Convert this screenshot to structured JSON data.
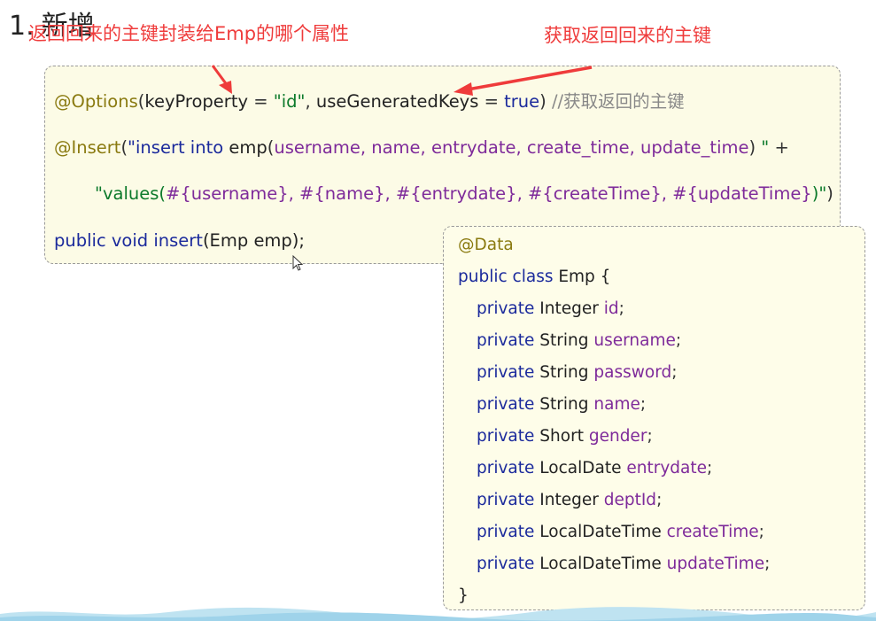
{
  "heading": {
    "number": "1.",
    "title": "新增"
  },
  "annotations": {
    "left": "返回回来的主键封装给Emp的哪个属性",
    "right": "获取返回回来的主键"
  },
  "mapper_code": {
    "l1_annotation": "@Options",
    "l1_paren_open": "(",
    "l1_key": "keyProperty",
    "l1_eq1": " = ",
    "l1_value1": "\"id\"",
    "l1_comma": ", ",
    "l1_key2": "useGeneratedKeys",
    "l1_eq2": " = ",
    "l1_value2": "true",
    "l1_paren_close": ")",
    "l1_comment": " //获取返回的主键",
    "l2_annotation": "@Insert",
    "l2_paren_open": "(",
    "l2_str_start": "\"insert into ",
    "l2_table": "emp",
    "l2_p_open": "(",
    "l2_columns": "username, name, entrydate, create_time, update_time",
    "l2_p_close": ")",
    "l2_str_end": " \"",
    "l2_plus": " +",
    "l3_str_start": "\"values(",
    "l3_params": "#{username}, #{name}, #{entrydate}, #{createTime}, #{updateTime}",
    "l3_str_end": ")\"",
    "l3_paren_close": ")",
    "l4_keywords": "public void insert",
    "l4_args": "(Emp emp);"
  },
  "class_code": {
    "annotation": "@Data",
    "decl_keywords": "public class",
    "decl_name": " Emp {",
    "fields": [
      {
        "mod": "private",
        "type": " Integer ",
        "name": "id",
        "end": ";"
      },
      {
        "mod": "private",
        "type": " String ",
        "name": "username",
        "end": ";"
      },
      {
        "mod": "private",
        "type": " String ",
        "name": "password",
        "end": ";"
      },
      {
        "mod": "private",
        "type": " String ",
        "name": "name",
        "end": ";"
      },
      {
        "mod": "private",
        "type": " Short ",
        "name": "gender",
        "end": ";"
      },
      {
        "mod": "private",
        "type": " LocalDate ",
        "name": "entrydate",
        "end": ";"
      },
      {
        "mod": "private",
        "type": " Integer ",
        "name": "deptId",
        "end": ";"
      },
      {
        "mod": "private",
        "type": " LocalDateTime ",
        "name": "createTime",
        "end": ";"
      },
      {
        "mod": "private",
        "type": " LocalDateTime ",
        "name": "updateTime",
        "end": ";"
      }
    ],
    "close": "}"
  },
  "colors": {
    "annotation_red": "#ef3b3b",
    "keyword": "#1b2a9c",
    "string": "#0c7a2b",
    "column": "#7e2a9a",
    "annotation_code": "#8a7a10"
  }
}
